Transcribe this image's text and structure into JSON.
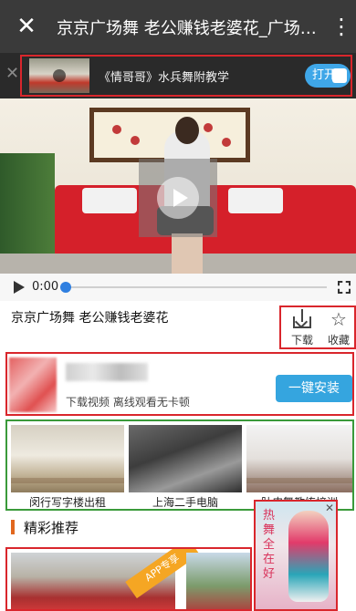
{
  "header": {
    "close_glyph": "✕",
    "title": "京京广场舞 老公赚钱老婆花_广场舞...",
    "more_glyph": "⋮"
  },
  "promo": {
    "close_glyph": "✕",
    "text": "《情哥哥》水兵舞附教学",
    "open_label": "打开"
  },
  "player": {
    "current_time": "0:00",
    "progress": 0
  },
  "video_info": {
    "title": "京京广场舞 老公赚钱老婆花",
    "download_label": "下载",
    "favorite_label": "收藏",
    "favorite_glyph": "☆"
  },
  "ad": {
    "description": "下载视频 离线观看无卡顿",
    "install_label": "一键安装"
  },
  "thumbnails": [
    {
      "label": "闵行写字楼出租"
    },
    {
      "label": "上海二手电脑"
    },
    {
      "label": "肚皮舞教练培训"
    }
  ],
  "section": {
    "title": "精彩推荐"
  },
  "recommend": {
    "tag": "APP专享"
  },
  "float_ad": {
    "text": "热舞全在好",
    "close_glyph": "✕"
  },
  "colors": {
    "titlebar": "#3a3a3a",
    "accent_blue": "#35a5df",
    "highlight_red": "#d9262c",
    "highlight_green": "#3a9a3a",
    "section_bar": "#e1671e"
  }
}
